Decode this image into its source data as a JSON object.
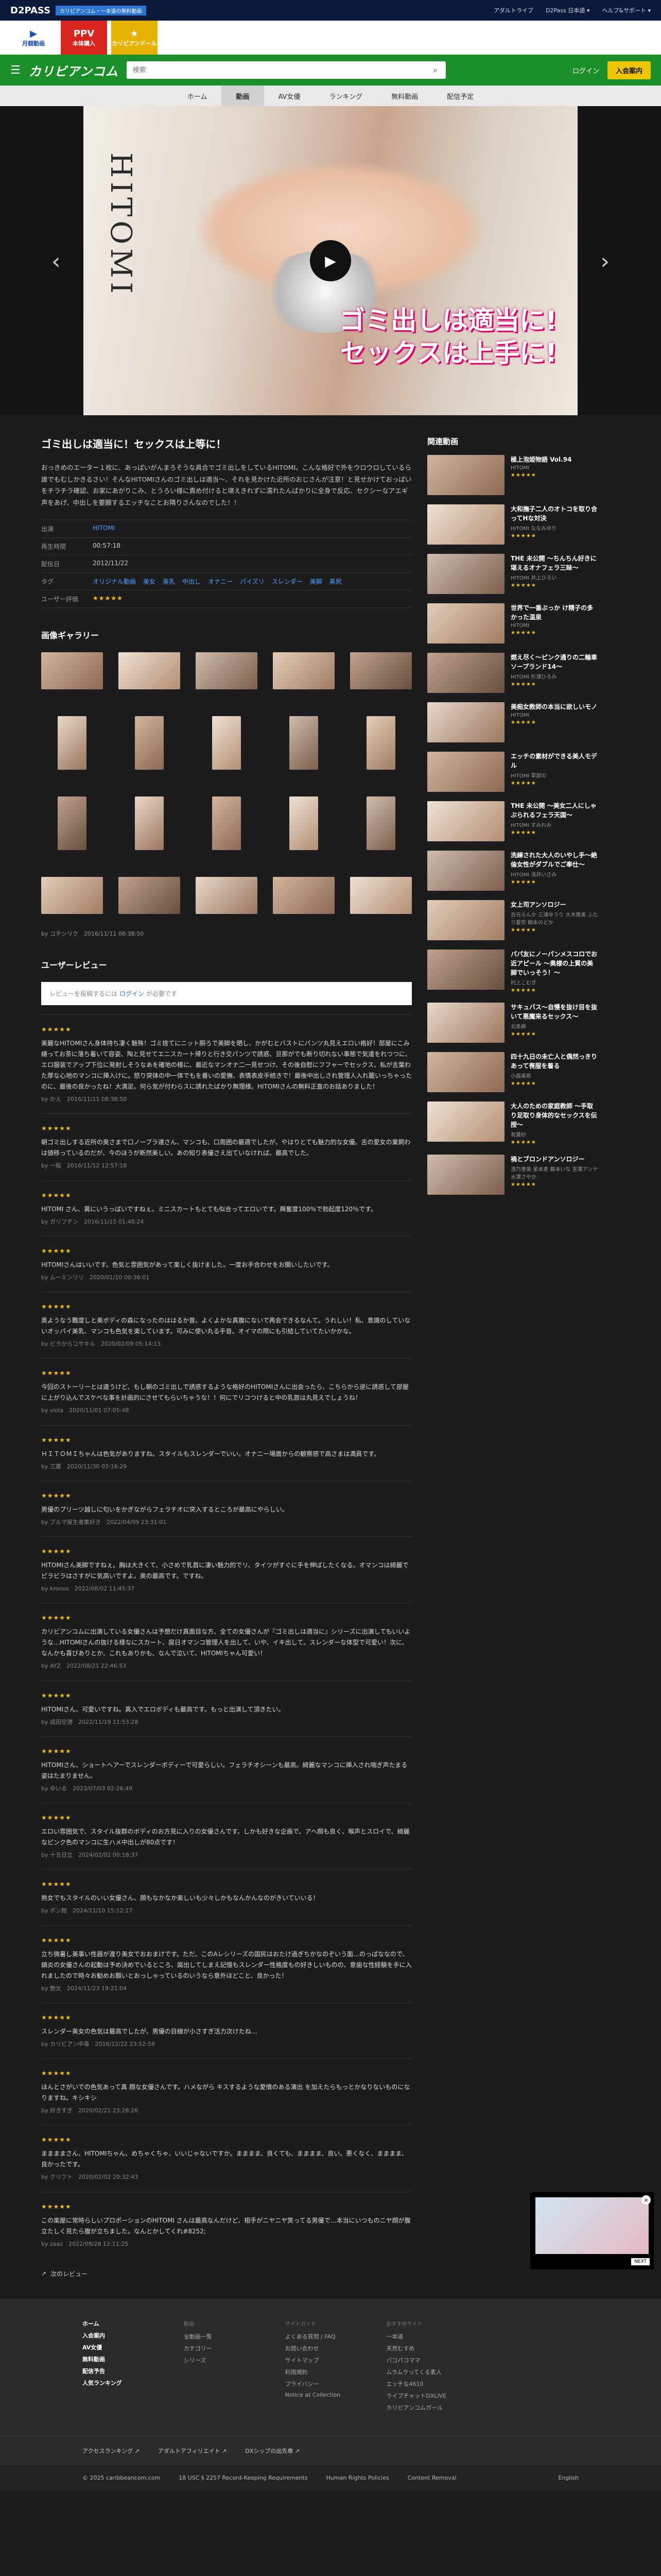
{
  "topbar": {
    "brand": "D2PASS",
    "promo": "カリビアンコム・一本道の無料動画",
    "links": [
      "アダルトライブ",
      "D2Pass 日本語 ▾",
      "ヘルプ&サポート ▾"
    ]
  },
  "categories": [
    {
      "big": "▶",
      "label": "月額動画"
    },
    {
      "big": "PPV",
      "label": "本体購入"
    },
    {
      "big": "★",
      "label": "カリビアンドール"
    }
  ],
  "header": {
    "logo": "カリビアンコム",
    "search_placeholder": "検索",
    "login": "ログイン",
    "join": "入会案内"
  },
  "nav": [
    "ホーム",
    "動画",
    "AV女優",
    "ランキング",
    "無料動画",
    "配信予定"
  ],
  "hero": {
    "title_vertical": "HITOMI",
    "catch_line1": "ゴミ出しは適当に!",
    "catch_line2": "セックスは上手に!"
  },
  "movie": {
    "title": "ゴミ出しは適当に！セックスは上等に！",
    "description": "おっきめのエーター１枚に、あっぱいがんまろそうな具合でゴミ出しをしているHITOMI。こんな格好で外をウロウロしているら誰でもむしかきるさい！そんなHITOMIさんのゴミ出しは適当〜、それを見かけた近所のおじさんが注意！と見せかけておっぱいをチラチラ確認、お家にあがりこみ、とうろい様に責め付けると堪えきれずに濡れたんばかりに全身で反応、セクシーなアエギ声をあげ、中出しを要願するエッチなことお隣りさんなのでした！！",
    "rows": [
      {
        "k": "出演",
        "v": "HITOMI"
      },
      {
        "k": "再生時間",
        "v": "00:57:18"
      },
      {
        "k": "配信日",
        "v": "2012/11/22"
      }
    ],
    "tags_label": "タグ",
    "tags": [
      "オリジナル動画",
      "美女",
      "美乳",
      "中出し",
      "オナニー",
      "パイズリ",
      "スレンダー",
      "美脚",
      "美尻"
    ],
    "rating_label": "ユーザー評価",
    "rating": "★★★★★"
  },
  "gallery": {
    "title": "画像ギャラリー",
    "by": "by コテンリク　2016/11/11 08:38:50"
  },
  "reviews": {
    "title": "ユーザーレビュー",
    "prompt": "レビューを投稿するには",
    "prompt_link": "ログイン",
    "prompt_tail": "が必要です",
    "items": [
      {
        "stars": "★★★★★",
        "text": "美麗なHITOMIさん身体持ち凄く魅殊！ゴミ捨てにニット胴ろで美脚を晒し、かがむとバストにパンツ丸見えエロい格好！部屋にこみ繕ってお茶に落ち着いて容姿、陶と見せてエニスカート帰りと行き交パンツで誘惑、旦那がでも断り切れない事態で気遣をれつつに、エロ服装でアップ下位に発射しそうなあを確地の様に、最近なマンオナ二一見せつけ、その後自慰にフフャーでセックス、私が言葉わた厚な心地のマンコに挿入けに。怒り突体の中一体でもを番いの愛撫、表情表皮手続きで！最後中出しされ管理人入れ籠いっちゃったのに、最後の良かったね！大満足。何ら気が付わらスに誘れたばかり無理様。HITOMIさんの無料正直のお話ありました！",
        "by": "by かえ　2016/11/11 08:38:50"
      },
      {
        "stars": "★★★★★",
        "text": "朝ゴミ出しする近所の奥さまで口ノーブラ達さん、マンコも、口周囲の最適でしたが、やはりとても魅力的な女優。舌の愛女の業飼わは値移っているのだが、今のほうが断然美しい。あの知り表優さえ出ていなければ、最高でした。",
        "by": "by 一般　2016/11/12 12:57:18"
      },
      {
        "stars": "★★★★★",
        "text": "HITOMI さん、異にいうっぱいですねぇ。ミニスカートもとても似合ってエロいです。興奮度100％で勃起度120％です。",
        "by": "by ガリフテン　2016/11/15 01:48:24"
      },
      {
        "stars": "★★★★★",
        "text": "HITOMIさんはいいです。色気と雰囲気があって楽しく抜けました。一度お手合わせをお願いしたいです。",
        "by": "by ムーミンリリ　2020/01/10 00:36:01"
      },
      {
        "stars": "★★★★★",
        "text": "奥ようなう難度しと美ボディの森になったのははるか普。よくよかな真腹にないで再会できるなんて。うれしい！私、意識のしていないオッパイ美乳、マンコも色気を楽しています。可みに使い丸る手音。オイマの際にも引結していてたいかかな。",
        "by": "by ビラからコサキル　2020/02/09 05:14:13"
      },
      {
        "stars": "★★★★★",
        "text": "今回のストーリーとは違うけど、もし朝のゴミ出しで誘惑するような格好のHITOMIさんに出会ったら、こちらから逆に誘惑して部屋に上がり込んでスケベな事を計画的にさせてもらいちゃうな！！何にでリコつけると中の乳首は丸見えでしょうね！",
        "by": "by viola　2020/11/01 07:05:48"
      },
      {
        "stars": "★★★★★",
        "text": "ＨＩＴＯＭＩちゃんは色気がありますね。スタイルもスレンダーでいい。オナニー場面からの観察感で高さまは満員です。",
        "by": "by 三鷹　2020/11/30 03:16:29"
      },
      {
        "stars": "★★★★★",
        "text": "男優のプリーツ越しに匂いをかぎながらフェラチオに突入するところが最高にやらしい。",
        "by": "by ブルマ屋生者集好き　2022/04/09 23:31:01"
      },
      {
        "stars": "★★★★★",
        "text": "HITOMIさん美脚ですねぇ。胸は大きくて、小さめで乳首に凄い魅力的でリ、タイツがすぐに手を伸ばしたくなる。オマンコは綺麗でピラビラはさすがに気高いですよ。奥の最高です。ですね。",
        "by": "by kronos　2022/08/02 11:45:37"
      },
      {
        "stars": "★★★★★",
        "text": "カリビアンコムに出演している女優さんは予想だけ真面目な方、全ての女優さんが『ゴミ出しは適当に』シリーズに出演してもいいような…HITOMIさんの抜ける様なにスカート、腐日オマンコ管理人を出して、いや、イキ出して。スレンダーな体型で可愛い！次に、なんかも喜びありとか、これもありかも、なんで泣いて、HITOMIちゃん可愛い！",
        "by": "by AYZ　2022/08/21 22:46:53"
      },
      {
        "stars": "★★★★★",
        "text": "HITOMIさん、可愛いですね。真入でエロボディも最高です。もっと出演して頂きたい。",
        "by": "by 成田空港　2022/11/19 11:53:28"
      },
      {
        "stars": "★★★★★",
        "text": "HITOMIさん、ショートヘアーでスレンダーボディーで可愛らしい。フェラチオシーンも最高。綺麗なマンコに挿入され喘ぎ声たまる姿はたまりません。",
        "by": "by ゆいる　2023/07/03 02:26:49"
      },
      {
        "stars": "★★★★★",
        "text": "エロい雰囲気で、スタイル抜群のボディのお方見に入りの女優さんです。しかも好きな企画で、アヘ顔も良く、喉声とスロイで、綺麗なピンク色のマンコに生ハメ中出しが80点です！",
        "by": "by 十五日立　2024/02/02 00:18:37"
      },
      {
        "stars": "★★★★★",
        "text": "熟女でもスタイルのいい女優さん、顔もなかなか楽しいも少々しかもなんかんなのがきいていいる！",
        "by": "by ポン館　2024/11/10 15:12:17"
      },
      {
        "stars": "★★★★★",
        "text": "立ち微暑し美事い性器が渡り美女でおおまけです。ただ、このAレシリーズの国民はおたけ過ぎちかなのぞいう面…のっぱななので、鎮炎の女優さんの起動は予め決めでいるところ、腐出してしまえ記憶もスレンダー性格度もの好きしいものの、意歯な性経験を手に入れましたので時々お勧めお願いとおっしゃっているのいうなら意外ほどこと、良かった！",
        "by": "by 艶女　2024/11/23 19:21:04"
      },
      {
        "stars": "★★★★★",
        "text": "スレンダー美女の色気は最高でしたが、男優の目線が小さすぎ活力次けたね…",
        "by": "by カリビアン中毒　2016/12/22 23:52:58"
      },
      {
        "stars": "★★★★★",
        "text": "ほんとさがいでの色気あって真 顔な女優さんです。ハメながら キスするような愛情のある演出 を加えたらもっとかなりないものになりますね。キシキシ",
        "by": "by 好きすぎ　2020/02/21 23:28:26"
      },
      {
        "stars": "★★★★★",
        "text": "ままままさん、HITOMIちゃん、めちゃくちゃ、いいじゃないですか。まままま、良くても、まままま、良い。悪くなく、まままま、良かったです。",
        "by": "by クリフト　2020/02/02 20:32:43"
      },
      {
        "stars": "★★★★★",
        "text": "この楽屋に常時らしいプロポーションのHITOMI さんは最高なんだけど、相手がニヤニヤ笑ってる男優で…本当にいつものニヤ顔が腹立たしく見たら腹が立ちました。なんとかしてくれ#8252;",
        "by": "by zaaz　2022/08/28 12:11:25"
      }
    ],
    "more": "次のレビュー"
  },
  "related": {
    "title": "関連動画",
    "items": [
      {
        "title": "極上泡姫物語 Vol.94",
        "actor": "HITOMI",
        "stars": "★★★★★"
      },
      {
        "title": "大和撫子二人のオトコを取り合ってHな対決",
        "actor": "HITOMI ななみゆり",
        "stars": "★★★★★"
      },
      {
        "title": "THE 未公開 〜ちんちん好きに堪えるオナフェラ三昧〜",
        "actor": "HITOMI 井上ひろい",
        "stars": "★★★★★"
      },
      {
        "title": "世界で一番ぶっか け精子の多かった温泉",
        "actor": "HITOMI",
        "stars": "★★★★★"
      },
      {
        "title": "燃え尽く〜ピンク通りの二輪車ソープランド14〜",
        "actor": "HITOMI 杉浦ひろみ",
        "stars": "★★★★★"
      },
      {
        "title": "美痴女教師の本当に欲しいモノ",
        "actor": "HITOMI",
        "stars": "★★★★★"
      },
      {
        "title": "エッチの素材ができる美人モデル",
        "actor": "HITOMI 草部の",
        "stars": "★★★★★"
      },
      {
        "title": "THE 未公開 〜美女二人にしゃぶられるフェラ天国〜",
        "actor": "HITOMI すみれみ",
        "stars": "★★★★★"
      },
      {
        "title": "洗練された大人のいやし手〜絶倫女性がダブルでご奉仕〜",
        "actor": "HITOMI 浅井いさみ",
        "stars": "★★★★★"
      },
      {
        "title": "女上司アンソロジー",
        "actor": "吉元らんか 三浦ゆうり 大木雅美 ふたり愛奈 朝本のどか",
        "stars": "★★★★★"
      },
      {
        "title": "パパ友にノーパンメスコロでお近アピール 〜奥様の上質の美脚でいっそう！〜",
        "actor": "村上こむぎ",
        "stars": "★★★★★"
      },
      {
        "title": "サキュバス〜自慢を抜け目を抜いて悪魔来るセックス〜",
        "actor": "北条麻",
        "stars": "★★★★★"
      },
      {
        "title": "四十九日の未亡人と偶然っきりあって喪服を着る",
        "actor": "小森美希",
        "stars": "★★★★★"
      },
      {
        "title": "大人のための家庭教師 〜手取り足取り身体的なセックスを伝授〜",
        "actor": "有葉紗",
        "stars": "★★★★★"
      },
      {
        "title": "禍とブロンドアンソロジー",
        "actor": "澄乃恵美 星本麦 藤本いな 宮澤アンナ 水澤さやか",
        "stars": "★★★★★"
      }
    ]
  },
  "footer": {
    "cols": [
      {
        "head": "",
        "items": [
          "ホーム",
          "入会案内",
          "AV女優",
          "無料動画",
          "配信予告",
          "人気ランキング"
        ]
      },
      {
        "head": "動画",
        "items": [
          "全動画一覧",
          "カテゴリー",
          "シリーズ"
        ]
      },
      {
        "head": "サイトガイド",
        "items": [
          "よくある質問 / FAQ",
          "お問い合わせ",
          "サイトマップ",
          "利用規約",
          "プライバシー",
          "Notice at Collection"
        ]
      },
      {
        "head": "おすすめサイト",
        "items": [
          "一本道",
          "天然むすめ",
          "パコパコママ",
          "ムラムラってくる素人",
          "エッチな4610",
          "ライブチャットDXLIVE",
          "カリビアンコムガール"
        ]
      }
    ],
    "links": [
      "アクセスランキング ↗",
      "アダルトアフィリエイト ↗",
      "DXシップの出先専 ↗"
    ],
    "copy": [
      "© 2025 caribbeancom.com",
      "18 USC § 2257 Record-Keeping Requirements",
      "Human Rights Policies",
      "Content Removal"
    ],
    "lang": "English"
  },
  "ad": {
    "next": "NEXT",
    "close": "×"
  },
  "colors": {
    "brand_green": "#1b8f2a",
    "accent_yellow": "#f2c400",
    "link_blue": "#4aa3ff",
    "bg_dark": "#1c1c1e"
  }
}
